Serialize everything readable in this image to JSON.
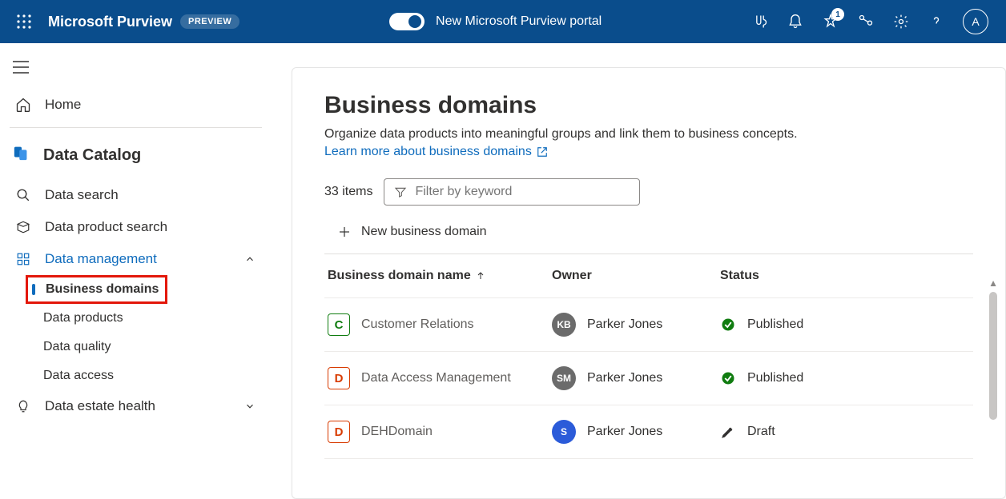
{
  "header": {
    "brand": "Microsoft Purview",
    "preview_badge": "PREVIEW",
    "toggle_label": "New Microsoft Purview portal",
    "notification_count": "1",
    "avatar_initial": "A"
  },
  "sidebar": {
    "home": "Home",
    "catalog_title": "Data Catalog",
    "items": [
      {
        "label": "Data search"
      },
      {
        "label": "Data product search"
      },
      {
        "label": "Data management"
      },
      {
        "label": "Data estate health"
      }
    ],
    "management_children": [
      {
        "label": "Business domains"
      },
      {
        "label": "Data products"
      },
      {
        "label": "Data quality"
      },
      {
        "label": "Data access"
      }
    ]
  },
  "main": {
    "title": "Business domains",
    "description": "Organize data products into meaningful groups and link them to business concepts.",
    "learn_link": "Learn more about business domains",
    "item_count": "33 items",
    "filter_placeholder": "Filter by keyword",
    "new_button": "New business domain",
    "columns": {
      "name": "Business domain name",
      "owner": "Owner",
      "status": "Status"
    },
    "rows": [
      {
        "letter": "C",
        "letter_color": "#107c10",
        "name": "Customer Relations",
        "owner_initials": "KB",
        "owner_bg": "#6b6b6b",
        "owner_name": "Parker Jones",
        "status": "Published",
        "status_type": "published"
      },
      {
        "letter": "D",
        "letter_color": "#d83b01",
        "name": "Data Access Management",
        "owner_initials": "SM",
        "owner_bg": "#6b6b6b",
        "owner_name": "Parker Jones",
        "status": "Published",
        "status_type": "published"
      },
      {
        "letter": "D",
        "letter_color": "#d83b01",
        "name": "DEHDomain",
        "owner_initials": "S",
        "owner_bg": "#2b5bd9",
        "owner_name": "Parker Jones",
        "status": "Draft",
        "status_type": "draft"
      }
    ]
  }
}
